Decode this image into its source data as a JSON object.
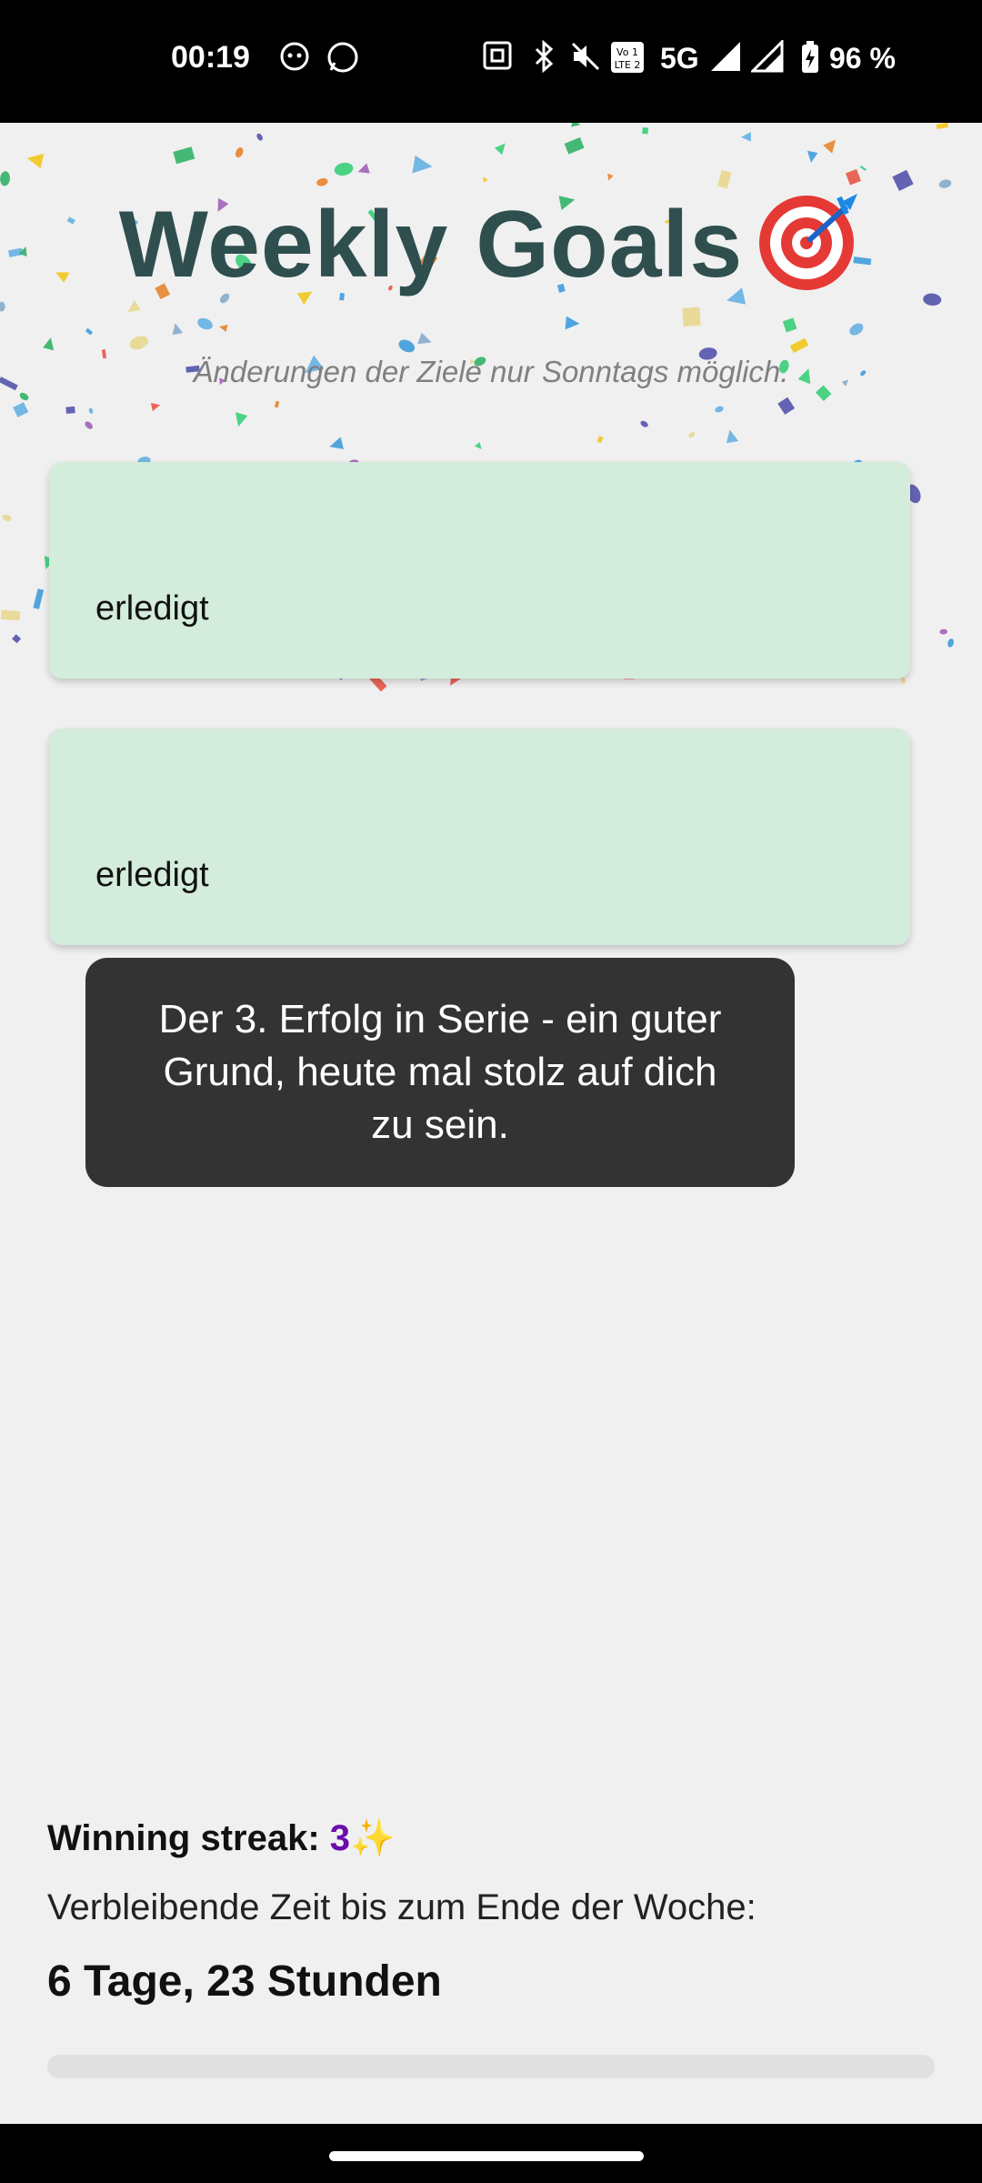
{
  "status_bar": {
    "time": "00:19",
    "network": "5G",
    "battery": "96 %",
    "icons": [
      "avatar-icon",
      "whatsapp-icon",
      "nfc-icon",
      "bluetooth-icon",
      "mute-icon",
      "volte-icon",
      "signal-icon",
      "signal-icon",
      "battery-charging-icon"
    ]
  },
  "header": {
    "title": "Weekly Goals",
    "title_icon": "target-dart-icon",
    "subtitle": "Änderungen der Ziele nur Sonntags möglich."
  },
  "goals": [
    {
      "status": "erledigt"
    },
    {
      "status": "erledigt"
    }
  ],
  "toast": {
    "message": "Der 3. Erfolg in Serie - ein guter Grund, heute mal stolz auf dich zu sein."
  },
  "footer": {
    "streak_label": "Winning streak:",
    "streak_value": "3",
    "streak_icon": "✨",
    "remaining_label": "Verbleibende Zeit bis zum Ende der Woche:",
    "remaining_value": "6 Tage, 23 Stunden",
    "week_progress": 0.0
  },
  "colors": {
    "title": "#2f4f4f",
    "card_bg": "#d4ecdb",
    "streak_value": "#6a0dad",
    "toast_bg": "#333333",
    "app_bg": "#f0f0f0"
  }
}
